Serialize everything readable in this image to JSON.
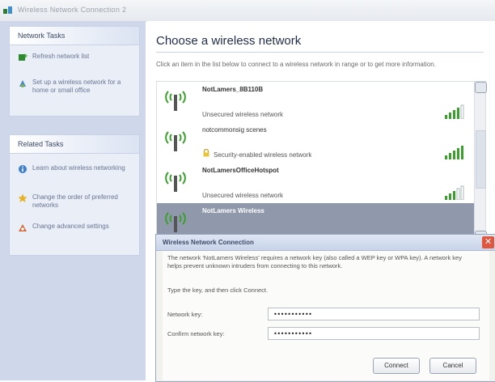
{
  "window": {
    "title": "Wireless Network Connection 2"
  },
  "sidebar": {
    "network_tasks": {
      "header": "Network Tasks",
      "items": [
        {
          "icon": "refresh-icon",
          "label": "Refresh network list"
        },
        {
          "icon": "setup-icon",
          "label": "Set up a wireless network for a home or small office"
        }
      ]
    },
    "related_tasks": {
      "header": "Related Tasks",
      "items": [
        {
          "icon": "info-icon",
          "label": "Learn about wireless networking"
        },
        {
          "icon": "star-icon",
          "label": "Change the order of preferred networks"
        },
        {
          "icon": "settings-icon",
          "label": "Change advanced settings"
        }
      ]
    }
  },
  "main": {
    "title": "Choose a wireless network",
    "instructions": "Click an item in the list below to connect to a wireless network in range or to get more information.",
    "networks": [
      {
        "ssid": "NotLamers_8B110B",
        "status": "Unsecured wireless network",
        "signal": 4,
        "secured": false
      },
      {
        "ssid": "notcommonsig scenes",
        "status": "Security-enabled wireless network",
        "signal": 5,
        "secured": true
      },
      {
        "ssid": "NotLamersOfficeHotspot",
        "status": "Unsecured wireless network",
        "signal": 3,
        "secured": false
      },
      {
        "ssid": "NotLamers Wireless",
        "status": "",
        "signal": 0,
        "secured": false,
        "selected": true
      }
    ]
  },
  "dialog": {
    "title": "Wireless Network Connection",
    "close_label": "✕",
    "description": "The network 'NotLamers Wireless' requires a network key (also called a WEP key or WPA key). A network key helps prevent unknown intruders from connecting to this network.",
    "prompt": "Type the key, and then click Connect.",
    "network_key_label": "Network key:",
    "network_key_value": "•••••••••••",
    "confirm_key_label": "Confirm network key:",
    "confirm_key_value": "•••••••••••",
    "connect_label": "Connect",
    "cancel_label": "Cancel"
  },
  "colors": {
    "sidebar_bg": "#cfd8ea",
    "selection": "#9099ac",
    "signal": "#3aa02c",
    "close": "#e0563f"
  }
}
